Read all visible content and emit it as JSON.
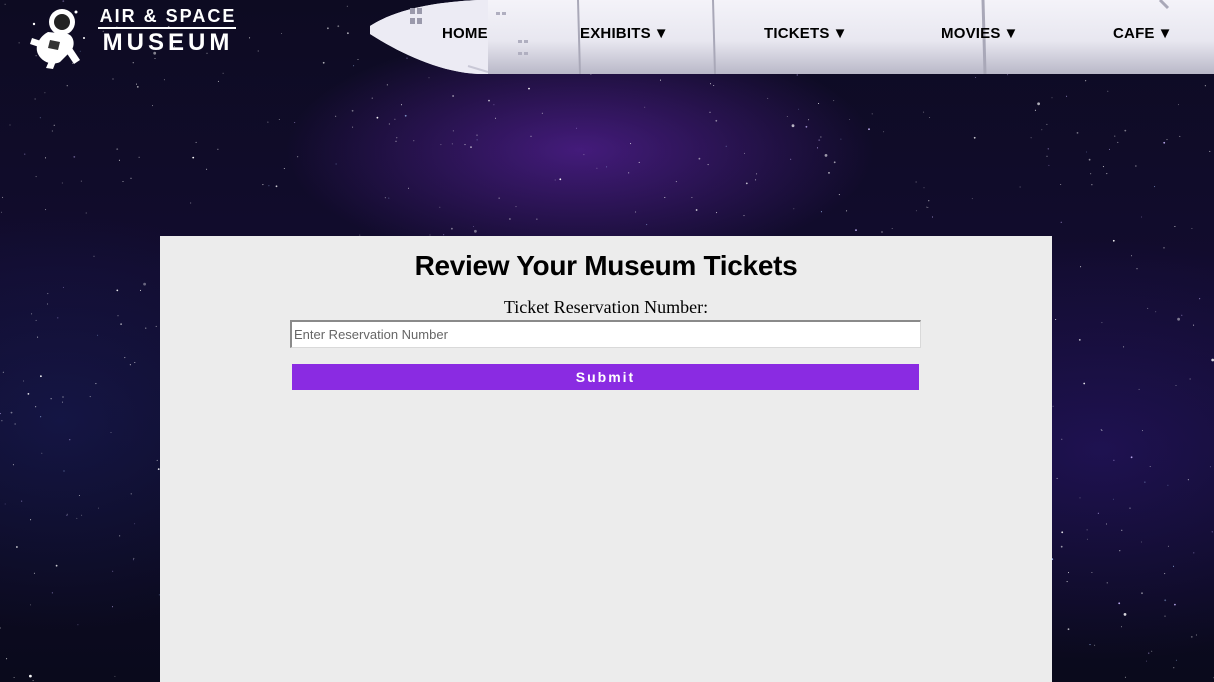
{
  "brand": {
    "line1": "AIR & SPACE",
    "line2": "MUSEUM",
    "icon": "astronaut-icon"
  },
  "nav": {
    "items": [
      {
        "label": "HOME",
        "caret": ""
      },
      {
        "label": "EXHIBITS",
        "caret": "▼"
      },
      {
        "label": "TICKETS",
        "caret": "▼"
      },
      {
        "label": "MOVIES",
        "caret": "▼"
      },
      {
        "label": "CAFE",
        "caret": "▼"
      }
    ]
  },
  "form": {
    "title": "Review Your Museum Tickets",
    "label": "Ticket Reservation Number:",
    "placeholder": "Enter Reservation Number",
    "value": "",
    "submit_label": "Submit"
  },
  "colors": {
    "accent": "#8a2be2",
    "card_bg": "#ececec",
    "space_bg": "#120c2e"
  }
}
